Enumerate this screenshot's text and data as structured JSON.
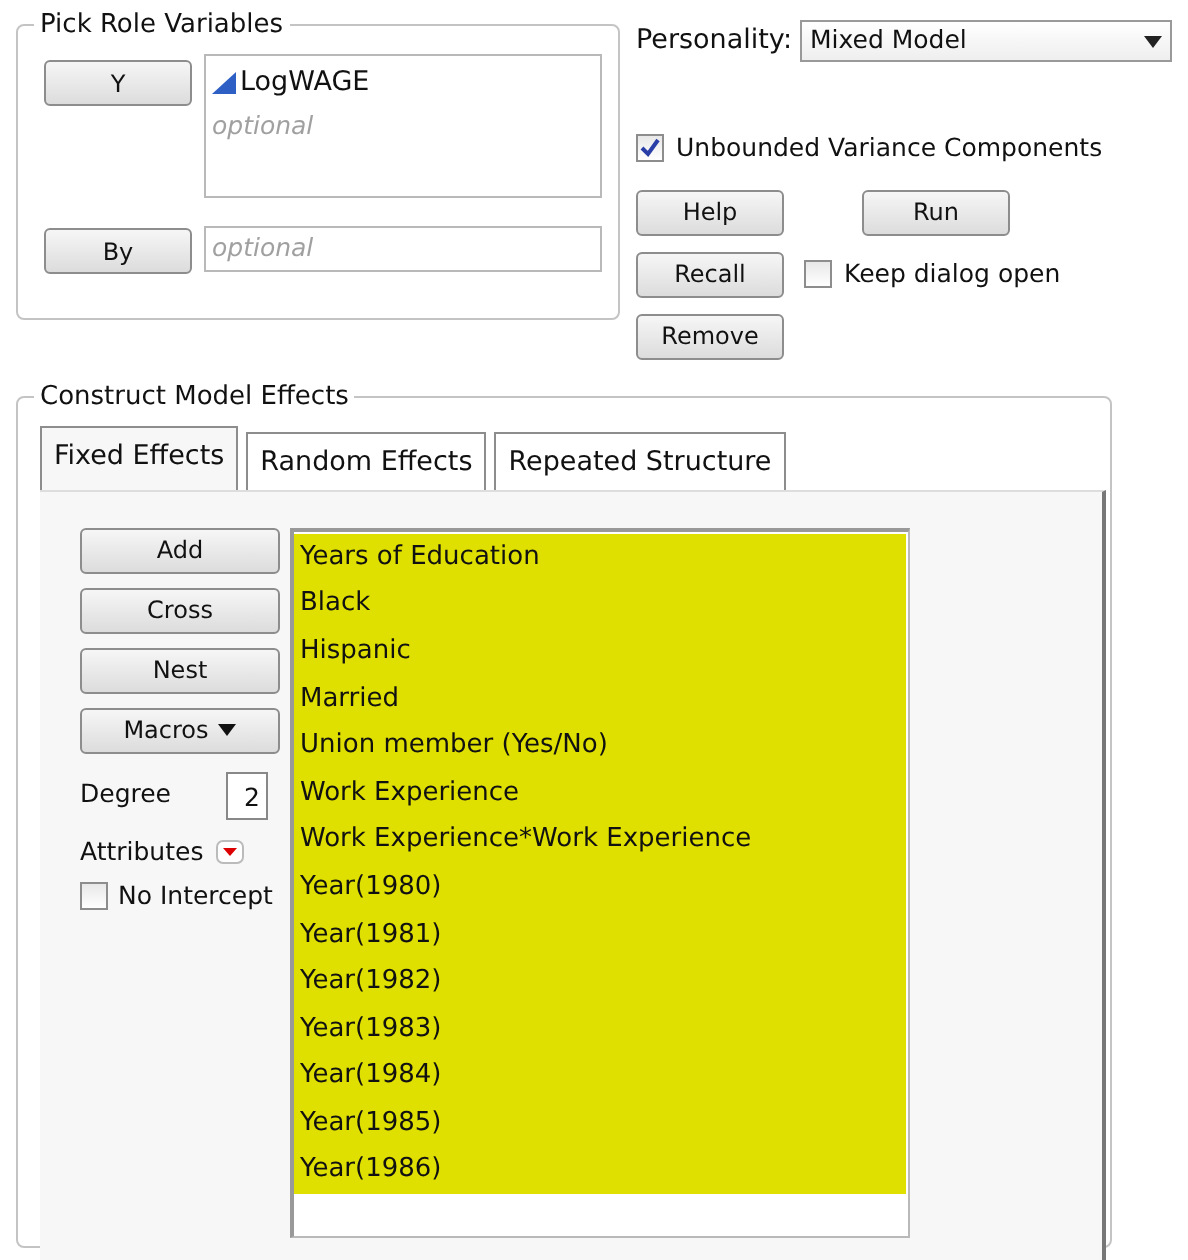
{
  "role_variables": {
    "title": "Pick Role Variables",
    "roles": [
      {
        "button": "Y",
        "kind": "list",
        "variables": [
          "LogWAGE"
        ],
        "placeholder": "optional"
      },
      {
        "button": "By",
        "kind": "field",
        "placeholder": "optional"
      }
    ]
  },
  "personality": {
    "label": "Personality:",
    "value": "Mixed Model"
  },
  "unbounded_variance": {
    "label": "Unbounded Variance Components",
    "checked": true
  },
  "actions": [
    "Help",
    "Run",
    "Recall",
    "Remove"
  ],
  "keep_dialog_open": {
    "label": "Keep dialog open",
    "checked": false
  },
  "model_effects": {
    "title": "Construct Model Effects",
    "tabs": [
      {
        "label": "Fixed Effects",
        "selected": true
      },
      {
        "label": "Random Effects",
        "selected": false
      },
      {
        "label": "Repeated Structure",
        "selected": false
      }
    ],
    "buttons": [
      {
        "label": "Add",
        "kind": "plain"
      },
      {
        "label": "Cross",
        "kind": "plain"
      },
      {
        "label": "Nest",
        "kind": "plain"
      },
      {
        "label": "Macros",
        "kind": "menu"
      }
    ],
    "degree": {
      "label": "Degree",
      "value": "2"
    },
    "attributes": {
      "label": "Attributes"
    },
    "no_intercept": {
      "label": "No Intercept",
      "checked": false
    },
    "effects": [
      {
        "name": "Years of Education",
        "selected": true
      },
      {
        "name": "Black",
        "selected": true
      },
      {
        "name": "Hispanic",
        "selected": true
      },
      {
        "name": "Married",
        "selected": true
      },
      {
        "name": "Union member (Yes/No)",
        "selected": true
      },
      {
        "name": "Work Experience",
        "selected": true
      },
      {
        "name": "Work Experience*Work Experience",
        "selected": true
      },
      {
        "name": "Year(1980)",
        "selected": true
      },
      {
        "name": "Year(1981)",
        "selected": true
      },
      {
        "name": "Year(1982)",
        "selected": true
      },
      {
        "name": "Year(1983)",
        "selected": true
      },
      {
        "name": "Year(1984)",
        "selected": true
      },
      {
        "name": "Year(1985)",
        "selected": true
      },
      {
        "name": "Year(1986)",
        "selected": true
      }
    ]
  }
}
